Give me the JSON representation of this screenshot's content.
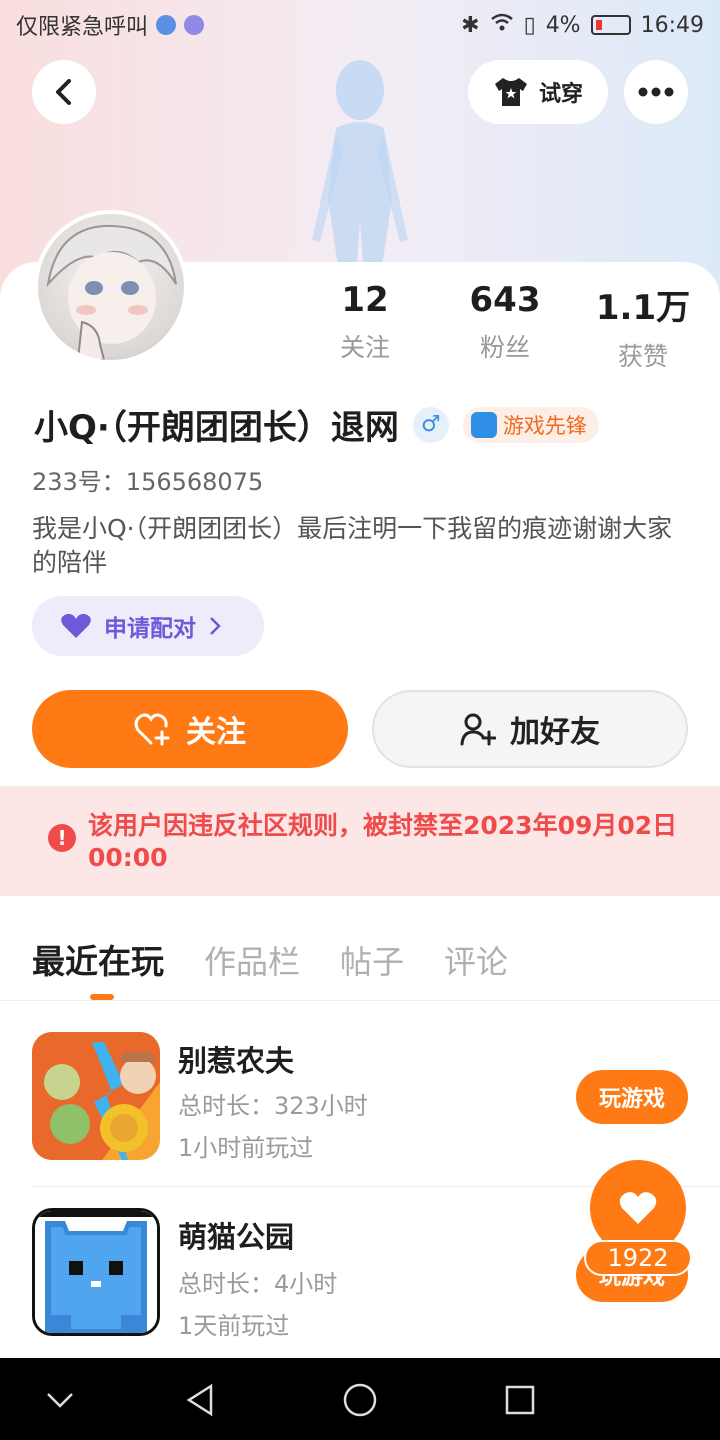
{
  "status_bar": {
    "carrier": "仅限紧急呼叫",
    "battery": "4%",
    "time": "16:49"
  },
  "header": {
    "try_on_label": "试穿"
  },
  "stats": [
    {
      "value": "12",
      "label": "关注"
    },
    {
      "value": "643",
      "label": "粉丝"
    },
    {
      "value": "1.1万",
      "label": "获赞"
    }
  ],
  "profile": {
    "name": "小Q·（开朗团团长）退网",
    "gender_symbol": "♂",
    "badge_label": "游戏先锋",
    "uid": "233号：156568075",
    "bio": "我是小Q·（开朗团团长）最后注明一下我留的痕迹谢谢大家的陪伴"
  },
  "actions": {
    "pair_label": "申请配对",
    "follow_label": "关注",
    "add_friend_label": "加好友"
  },
  "ban_notice": {
    "text": "该用户因违反社区规则，被封禁至2023年09月02日 00:00"
  },
  "tabs": [
    {
      "label": "最近在玩",
      "active": true
    },
    {
      "label": "作品栏",
      "active": false
    },
    {
      "label": "帖子",
      "active": false
    },
    {
      "label": "评论",
      "active": false
    }
  ],
  "games": [
    {
      "title": "别惹农夫",
      "duration": "总时长：323小时",
      "last_played": "1小时前玩过",
      "button": "玩游戏"
    },
    {
      "title": "萌猫公园",
      "duration": "总时长：4小时",
      "last_played": "1天前玩过",
      "button": "玩游戏"
    }
  ],
  "like_float": {
    "count": "1922"
  },
  "colors": {
    "accent": "#ff7a14",
    "ban_text": "#ef4b4b",
    "ban_bg": "#fde6e6",
    "pair_text": "#6c5ad8"
  }
}
